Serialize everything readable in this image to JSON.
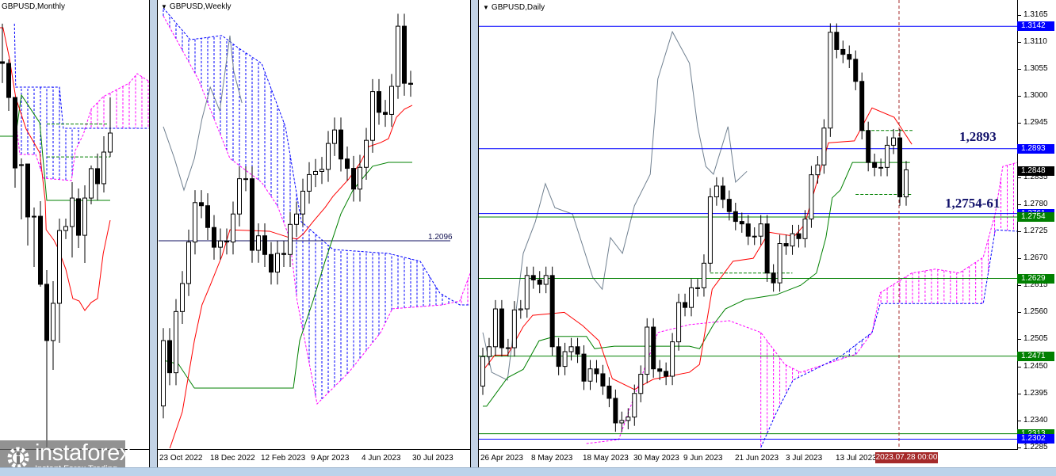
{
  "panels": {
    "monthly": {
      "title": "GBPUSD,Monthly"
    },
    "weekly": {
      "title": "GBPUSD,Weekly",
      "level_label": "1.2096",
      "time_labels": [
        "23 Oct 2022",
        "18 Dec 2022",
        "12 Feb 2023",
        "9 Apr 2023",
        "4 Jun 2023",
        "30 Jul 2023"
      ]
    },
    "daily": {
      "title": "GBPUSD,Daily",
      "time_labels": [
        "26 Apr 2023",
        "8 May 2023",
        "18 May 2023",
        "30 May 2023",
        "9 Jun 2023",
        "21 Jun 2023",
        "3 Jul 2023",
        "13 Jul 2023"
      ],
      "cursor_time": "2023.07.28 00:00",
      "annotations": {
        "upper": "1,2893",
        "lower": "1,2754-61"
      }
    }
  },
  "logo": {
    "name": "instaforex",
    "tagline": "Instant Forex Trading"
  },
  "colors": {
    "bull": "#ffffff",
    "bear": "#000000",
    "tenkan": "#ff0000",
    "kijun": "#008000",
    "chikou": "#708090",
    "cloud_a": "#ff00ff",
    "cloud_b": "#0000ff",
    "level_blue": "#0000ff",
    "level_green": "#008000",
    "cursor": "#a52a2a"
  },
  "chart_data": [
    {
      "type": "candlestick",
      "symbol": "GBPUSD",
      "timeframe": "Monthly",
      "ohlc": [
        [
          1.3371,
          1.3649,
          1.3215,
          1.3359
        ],
        [
          1.3359,
          1.3388,
          1.3012,
          1.311
        ],
        [
          1.311,
          1.311,
          1.2451,
          1.2595
        ],
        [
          1.2619,
          1.2665,
          1.2219,
          1.2619
        ],
        [
          1.2624,
          1.2624,
          1.2028,
          1.2237
        ],
        [
          1.2242,
          1.2306,
          1.1872,
          1.2242
        ],
        [
          1.2242,
          1.2352,
          1.1727,
          1.1745
        ],
        [
          1.1745,
          1.1849,
          1.035,
          1.1334
        ],
        [
          1.1334,
          1.1768,
          1.112,
          1.1606
        ],
        [
          1.1606,
          1.2225,
          1.1317,
          1.2138
        ],
        [
          1.2138,
          1.2225,
          1.2075,
          1.2167
        ],
        [
          1.2167,
          1.2491,
          1.1941,
          1.2375
        ],
        [
          1.237,
          1.2445,
          1.2011,
          1.2103
        ],
        [
          1.2103,
          1.2468,
          1.1901,
          1.2375
        ],
        [
          1.2375,
          1.2613,
          1.2329,
          1.259
        ],
        [
          1.259,
          1.27,
          1.2358,
          1.248
        ],
        [
          1.248,
          1.2827,
          1.2416,
          1.2711
        ],
        [
          1.2711,
          1.311,
          1.2676,
          1.285
        ]
      ],
      "tenkan": [
        [
          -0.4,
          1.362
        ],
        [
          0.1,
          1.362
        ],
        [
          1.1,
          1.34
        ],
        [
          2.1,
          1.311
        ],
        [
          3.75,
          1.2879
        ],
        [
          5.9,
          1.2705
        ],
        [
          6.75,
          1.2358
        ],
        [
          6.9,
          1.2144
        ],
        [
          8.1,
          1.2069
        ],
        [
          8.75,
          1.2011
        ],
        [
          10,
          1.1855
        ],
        [
          11.1,
          1.1641
        ],
        [
          12.1,
          1.1623
        ],
        [
          13,
          1.1554
        ],
        [
          14,
          1.1612
        ],
        [
          15,
          1.1641
        ],
        [
          15.9,
          1.197
        ],
        [
          17,
          1.2213
        ]
      ],
      "kijun": [
        [
          -0.4,
          1.2827
        ],
        [
          2.1,
          1.2827
        ],
        [
          3,
          1.3128
        ],
        [
          5.9,
          1.2925
        ],
        [
          7,
          1.2358
        ],
        [
          17,
          1.2358
        ]
      ],
      "senkou_b": [
        [
          1.9,
          1.3649
        ],
        [
          2.1,
          1.3186
        ],
        [
          9,
          1.3186
        ],
        [
          9.6,
          1.2885
        ],
        [
          23.1,
          1.2885
        ]
      ],
      "senkou_a": [
        [
          2.1,
          1.2954
        ],
        [
          2.75,
          1.2694
        ],
        [
          5.25,
          1.2694
        ],
        [
          6.5,
          1.252
        ],
        [
          10.9,
          1.2503
        ],
        [
          11.5,
          1.2723
        ],
        [
          12.75,
          1.2838
        ],
        [
          14,
          1.3024
        ],
        [
          15.9,
          1.3116
        ],
        [
          20,
          1.3215
        ],
        [
          21.25,
          1.3284
        ],
        [
          23,
          1.3232
        ]
      ],
      "levels": [
        {
          "price": 1.2676,
          "style": "dashed",
          "color": "green",
          "from": 7,
          "to": 17
        },
        {
          "price": 1.2916,
          "style": "dashed",
          "color": "green",
          "from": 7,
          "to": 16.5
        }
      ]
    },
    {
      "type": "candlestick",
      "symbol": "GBPUSD",
      "timeframe": "Weekly",
      "x_labels": [
        "23 Oct 2022",
        "18 Dec 2022",
        "12 Feb 2023",
        "9 Apr 2023",
        "4 Jun 2023",
        "30 Jul 2023"
      ],
      "close": [
        1.1615,
        1.146,
        1.1755,
        1.189,
        1.209,
        1.228,
        1.2265,
        1.216,
        1.2065,
        1.2095,
        1.209,
        1.2225,
        1.2395,
        1.2395,
        1.205,
        1.212,
        1.203,
        1.1945,
        1.2035,
        1.203,
        1.2175,
        1.2225,
        1.2335,
        1.2415,
        1.243,
        1.244,
        1.2565,
        1.263,
        1.249,
        1.2445,
        1.2345,
        1.245,
        1.258,
        1.2815,
        1.2715,
        1.2705,
        1.284,
        1.313,
        1.2855,
        1.285
      ],
      "first_open": 1.13,
      "tenkan": [
        [
          0,
          1.1004
        ],
        [
          3,
          1.1272
        ],
        [
          4.9,
          1.1615
        ],
        [
          6.1,
          1.1787
        ],
        [
          7.4,
          1.1882
        ],
        [
          9.25,
          1.2023
        ],
        [
          10.5,
          1.2149
        ],
        [
          16.75,
          1.2142
        ],
        [
          19.9,
          1.2111
        ],
        [
          21.1,
          1.2104
        ],
        [
          22.1,
          1.213
        ],
        [
          23.6,
          1.2188
        ],
        [
          25.5,
          1.2256
        ],
        [
          26.75,
          1.231
        ],
        [
          29.25,
          1.2394
        ],
        [
          31.1,
          1.2474
        ],
        [
          32.4,
          1.255
        ],
        [
          34.25,
          1.2569
        ],
        [
          35.5,
          1.2588
        ],
        [
          36.75,
          1.2691
        ],
        [
          38,
          1.273
        ],
        [
          39.25,
          1.2749
        ]
      ],
      "kijun": [
        [
          0,
          1.152
        ],
        [
          2.4,
          1.1501
        ],
        [
          4.9,
          1.1386
        ],
        [
          20.5,
          1.1386
        ],
        [
          21.5,
          1.1615
        ],
        [
          23.6,
          1.1806
        ],
        [
          25.5,
          1.1997
        ],
        [
          26.75,
          1.2111
        ],
        [
          28,
          1.2226
        ],
        [
          29.9,
          1.234
        ],
        [
          31.75,
          1.2409
        ],
        [
          33,
          1.2455
        ],
        [
          35.5,
          1.2474
        ],
        [
          39.25,
          1.2474
        ]
      ],
      "chikou": [
        [
          0,
          1.2646
        ],
        [
          1.75,
          1.2493
        ],
        [
          3.25,
          1.234
        ],
        [
          4.9,
          1.2493
        ],
        [
          6.1,
          1.2684
        ],
        [
          7.4,
          1.2836
        ],
        [
          8.9,
          1.2722
        ],
        [
          10.5,
          1.3085
        ],
        [
          11.1,
          1.2913
        ],
        [
          12.4,
          1.276
        ]
      ],
      "senkou_b": [
        [
          0,
          1.3218
        ],
        [
          4.25,
          1.3065
        ],
        [
          9.25,
          1.3085
        ],
        [
          11.75,
          1.3027
        ],
        [
          15.5,
          1.2951
        ],
        [
          19.25,
          1.2646
        ],
        [
          21.75,
          1.2188
        ],
        [
          26.75,
          1.2054
        ],
        [
          35.5,
          1.2035
        ],
        [
          40.5,
          1.1997
        ],
        [
          43.6,
          1.1844
        ],
        [
          46.75,
          1.1787
        ],
        [
          48.4,
          1.1787
        ]
      ],
      "senkou_a": [
        [
          0,
          1.318
        ],
        [
          5.5,
          1.2875
        ],
        [
          10.5,
          1.2493
        ],
        [
          15.5,
          1.2378
        ],
        [
          18,
          1.2264
        ],
        [
          19.9,
          1.2111
        ],
        [
          21.1,
          1.1806
        ],
        [
          24.25,
          1.131
        ],
        [
          29.25,
          1.1462
        ],
        [
          34.25,
          1.1653
        ],
        [
          36.1,
          1.1768
        ],
        [
          44,
          1.1787
        ],
        [
          46.75,
          1.1806
        ],
        [
          48.4,
          1.194
        ]
      ],
      "levels": [
        {
          "price": 1.2096,
          "style": "solid",
          "color": "navy",
          "label": "1.2096"
        }
      ]
    },
    {
      "type": "candlestick",
      "symbol": "GBPUSD",
      "timeframe": "Daily",
      "x_labels": [
        "26 Apr 2023",
        "8 May 2023",
        "18 May 2023",
        "30 May 2023",
        "9 Jun 2023",
        "21 Jun 2023",
        "3 Jul 2023",
        "13 Jul 2023"
      ],
      "close": [
        1.247,
        1.249,
        1.2567,
        1.2488,
        1.2488,
        1.2565,
        1.2567,
        1.2635,
        1.2626,
        1.2617,
        1.2635,
        1.249,
        1.245,
        1.248,
        1.249,
        1.2475,
        1.242,
        1.2445,
        1.2435,
        1.241,
        1.2385,
        1.2335,
        1.234,
        1.2347,
        1.2395,
        1.2434,
        1.253,
        1.2445,
        1.244,
        1.243,
        1.25,
        1.258,
        1.257,
        1.261,
        1.261,
        1.266,
        1.2795,
        1.2817,
        1.279,
        1.2765,
        1.2745,
        1.274,
        1.2715,
        1.2715,
        1.274,
        1.264,
        1.262,
        1.27,
        1.2695,
        1.272,
        1.271,
        1.275,
        1.284,
        1.286,
        1.2935,
        1.313,
        1.3095,
        1.3085,
        1.3075,
        1.303,
        1.293,
        1.2865,
        1.2855,
        1.2855,
        1.29,
        1.2915,
        1.2795,
        1.285
      ],
      "first_open": 1.241,
      "price_ticks": [
        "1.3165",
        "1.3110",
        "1.3055",
        "1.3000",
        "1.2945",
        "1.2835",
        "1.2780",
        "1.2725",
        "1.2670",
        "1.2615",
        "1.2560",
        "1.2505",
        "1.2450",
        "1.2395",
        "1.2340",
        "1.2285"
      ],
      "levels": [
        {
          "price": 1.3142,
          "label": "1.3142",
          "color": "blue"
        },
        {
          "price": 1.2893,
          "label": "1.2893",
          "color": "blue"
        },
        {
          "price": 1.2761,
          "label": "1.2761",
          "color": "blue"
        },
        {
          "price": 1.2754,
          "label": "1.2754",
          "color": "green"
        },
        {
          "price": 1.2629,
          "label": "1.2629",
          "color": "green"
        },
        {
          "price": 1.2471,
          "label": "1.2471",
          "color": "green"
        },
        {
          "price": 1.2313,
          "label": "1.2313",
          "color": "green"
        },
        {
          "price": 1.2302,
          "label": "1.2302",
          "color": "blue"
        }
      ],
      "current_price": {
        "price": 1.2848,
        "label": "1.2848"
      },
      "tenkan": [
        [
          0,
          1.2441
        ],
        [
          1.9,
          1.2473
        ],
        [
          3.9,
          1.2473
        ],
        [
          6.4,
          1.2531
        ],
        [
          7.9,
          1.2554
        ],
        [
          12.9,
          1.256
        ],
        [
          15.8,
          1.2533
        ],
        [
          18.4,
          1.2502
        ],
        [
          20.5,
          1.2425
        ],
        [
          24,
          1.2403
        ],
        [
          27,
          1.2424
        ],
        [
          32.7,
          1.2438
        ],
        [
          34.3,
          1.2454
        ],
        [
          36.3,
          1.2607
        ],
        [
          39.6,
          1.2664
        ],
        [
          42.8,
          1.267
        ],
        [
          45.3,
          1.2723
        ],
        [
          49.3,
          1.2715
        ],
        [
          50.9,
          1.2738
        ],
        [
          54.7,
          1.2905
        ],
        [
          58.8,
          1.2909
        ],
        [
          61.6,
          1.2976
        ],
        [
          65.1,
          1.2957
        ],
        [
          67.9,
          1.2902
        ]
      ],
      "kijun": [
        [
          0,
          1.2369
        ],
        [
          0.6,
          1.2369
        ],
        [
          3.9,
          1.2427
        ],
        [
          6.4,
          1.2444
        ],
        [
          8.9,
          1.2502
        ],
        [
          11.4,
          1.2511
        ],
        [
          16.4,
          1.2511
        ],
        [
          17.7,
          1.2486
        ],
        [
          20.8,
          1.2491
        ],
        [
          32.7,
          1.2491
        ],
        [
          34.3,
          1.2486
        ],
        [
          36.5,
          1.2535
        ],
        [
          38.4,
          1.2567
        ],
        [
          41.5,
          1.2586
        ],
        [
          46.5,
          1.2596
        ],
        [
          50.3,
          1.2615
        ],
        [
          52.8,
          1.264
        ],
        [
          54.3,
          1.2712
        ],
        [
          55.3,
          1.2793
        ],
        [
          56.6,
          1.2809
        ],
        [
          58.5,
          1.2865
        ],
        [
          67.6,
          1.2865
        ]
      ],
      "chikou": [
        [
          0,
          1.2519
        ],
        [
          1.4,
          1.2438
        ],
        [
          3.9,
          1.2422
        ],
        [
          6.4,
          1.268
        ],
        [
          8.3,
          1.2744
        ],
        [
          9.9,
          1.2822
        ],
        [
          11.4,
          1.2773
        ],
        [
          14.2,
          1.276
        ],
        [
          15.8,
          1.2696
        ],
        [
          17.4,
          1.2631
        ],
        [
          18.9,
          1.2607
        ],
        [
          20.2,
          1.2712
        ],
        [
          22.1,
          1.268
        ],
        [
          24,
          1.2777
        ],
        [
          26.5,
          1.2841
        ],
        [
          27.7,
          1.3035
        ],
        [
          30,
          1.3131
        ],
        [
          32.7,
          1.3067
        ],
        [
          34,
          1.2938
        ],
        [
          35.3,
          1.2857
        ],
        [
          36.5,
          1.2841
        ],
        [
          38.8,
          1.2938
        ],
        [
          40,
          1.2825
        ],
        [
          41.8,
          1.2847
        ]
      ],
      "senkou_a": [
        [
          16.4,
          1.2293
        ],
        [
          21.5,
          1.2301
        ],
        [
          24,
          1.239
        ],
        [
          27.7,
          1.2519
        ],
        [
          32.7,
          1.2535
        ],
        [
          39,
          1.2543
        ],
        [
          44,
          1.2519
        ],
        [
          47.8,
          1.2454
        ],
        [
          50.3,
          1.2438
        ],
        [
          59.1,
          1.2475
        ],
        [
          61.6,
          1.2519
        ],
        [
          62.9,
          1.26
        ],
        [
          67.9,
          1.264
        ],
        [
          71.6,
          1.2648
        ],
        [
          75.4,
          1.264
        ],
        [
          79.2,
          1.2672
        ],
        [
          81.1,
          1.2761
        ],
        [
          82.3,
          1.2857
        ],
        [
          84.6,
          1.2865
        ]
      ],
      "senkou_b": [
        [
          44,
          1.2285
        ],
        [
          46.5,
          1.2357
        ],
        [
          49.1,
          1.2422
        ],
        [
          56.6,
          1.247
        ],
        [
          61.6,
          1.2519
        ],
        [
          62.9,
          1.2578
        ],
        [
          79.2,
          1.2578
        ],
        [
          81.1,
          1.2728
        ],
        [
          84.6,
          1.2725
        ]
      ],
      "dashed_levels": [
        {
          "price": 1.293,
          "from": 60,
          "to": 68
        },
        {
          "price": 1.28,
          "from": 59,
          "to": 68
        },
        {
          "price": 1.264,
          "from": 36,
          "to": 49
        }
      ],
      "cursor_index": 67
    }
  ]
}
